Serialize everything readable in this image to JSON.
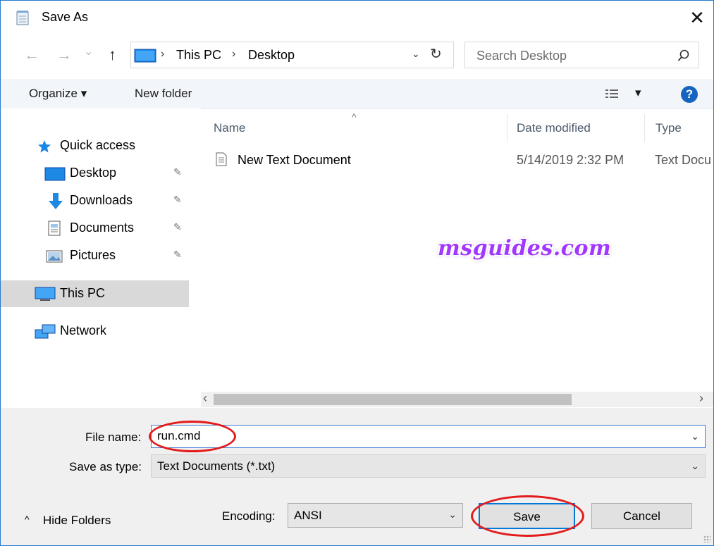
{
  "window": {
    "title": "Save As",
    "close_glyph": "✕"
  },
  "nav": {
    "back_glyph": "←",
    "forward_glyph": "→",
    "recent_glyph": "⌄",
    "up_glyph": "↑",
    "breadcrumb": [
      "This PC",
      "Desktop"
    ],
    "breadcrumb_sep": "›",
    "dropdown_glyph": "⌄",
    "refresh_glyph": "↻",
    "search_placeholder": "Search Desktop"
  },
  "toolbar": {
    "organize_label": "Organize ▾",
    "new_folder_label": "New folder",
    "view_glyph": "▾",
    "help_glyph": "?"
  },
  "sidebar": {
    "quick_access": "Quick access",
    "pinned": [
      {
        "label": "Desktop",
        "icon": "desktop-icon"
      },
      {
        "label": "Downloads",
        "icon": "downloads-icon"
      },
      {
        "label": "Documents",
        "icon": "documents-icon"
      },
      {
        "label": "Pictures",
        "icon": "pictures-icon"
      }
    ],
    "pin_glyph": "📌",
    "this_pc": "This PC",
    "network": "Network"
  },
  "list": {
    "columns": [
      "Name",
      "Date modified",
      "Type"
    ],
    "sort_glyph": "^",
    "rows": [
      {
        "name": "New Text Document",
        "date": "5/14/2019 2:32 PM",
        "type": "Text Docu"
      }
    ],
    "watermark": "msguides.com"
  },
  "scroll": {
    "left_glyph": "‹",
    "right_glyph": "›"
  },
  "form": {
    "file_name_label": "File name:",
    "file_name_value": "run.cmd",
    "save_type_label": "Save as type:",
    "save_type_value": "Text Documents (*.txt)",
    "encoding_label": "Encoding:",
    "encoding_value": "ANSI",
    "chevron": "⌄"
  },
  "footer": {
    "hide_folders": "Hide Folders",
    "hide_glyph": "^",
    "save_label": "Save",
    "cancel_label": "Cancel"
  },
  "colors": {
    "accent": "#0078d7",
    "highlight_oval": "#e31b1b",
    "selected_bg": "#d9d9d9",
    "watermark": "#a238ff"
  }
}
